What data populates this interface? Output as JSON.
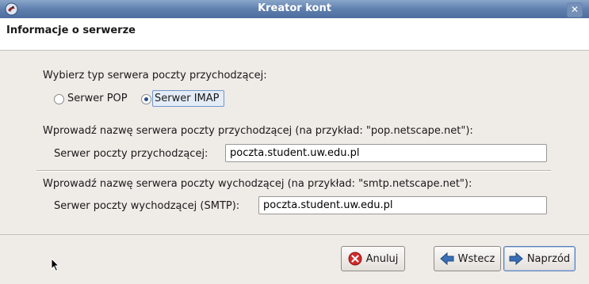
{
  "window": {
    "title": "Kreator kont",
    "close_glyph": "✕"
  },
  "header": {
    "title": "Informacje o serwerze"
  },
  "server_type": {
    "prompt": "Wybierz typ serwera poczty przychodzącej:",
    "options": [
      {
        "label": "Serwer POP",
        "selected": false
      },
      {
        "label": "Serwer IMAP",
        "selected": true
      }
    ]
  },
  "incoming": {
    "description": "Wprowadź nazwę serwera poczty przychodzącej (na przykład: \"pop.netscape.net\"):",
    "label": "Serwer poczty przychodzącej:",
    "value": "poczta.student.uw.edu.pl"
  },
  "outgoing": {
    "description": "Wprowadź nazwę serwera poczty wychodzącej (na przykład: \"smtp.netscape.net\"):",
    "label": "Serwer poczty wychodzącej (SMTP):",
    "value": "poczta.student.uw.edu.pl"
  },
  "buttons": {
    "cancel": "Anuluj",
    "back": "Wstecz",
    "next": "Naprzód"
  },
  "icons": {
    "app": "thunderbird-icon",
    "cancel": "cancel-icon",
    "back": "arrow-left-icon",
    "next": "arrow-right-icon"
  },
  "colors": {
    "titlebar": "#5f7fae",
    "cancel_icon": "#d42a2a",
    "arrow_icon": "#3b6fb6"
  }
}
